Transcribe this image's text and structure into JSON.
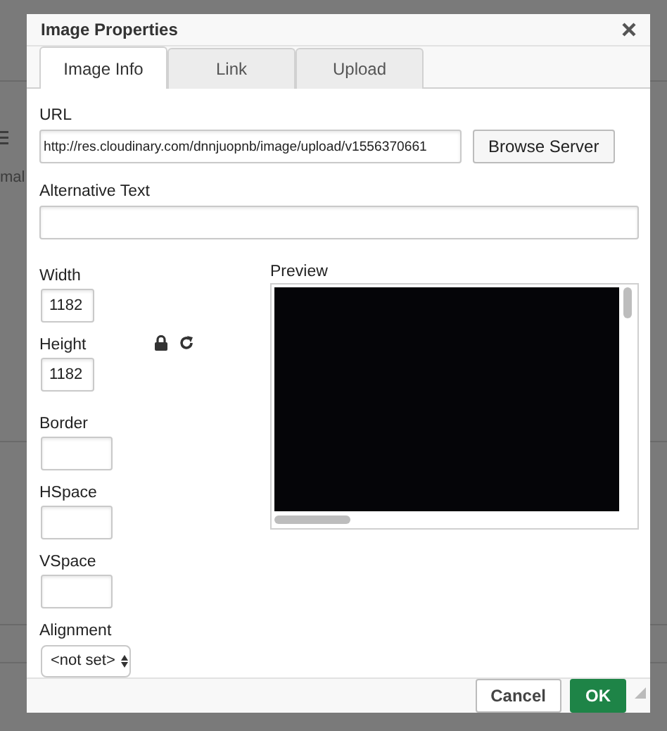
{
  "background": {
    "text": "mal"
  },
  "dialog": {
    "title": "Image Properties",
    "tabs": [
      {
        "label": "Image Info",
        "selected": true
      },
      {
        "label": "Link",
        "selected": false
      },
      {
        "label": "Upload",
        "selected": false
      }
    ],
    "url": {
      "label": "URL",
      "value": "http://res.cloudinary.com/dnnjuopnb/image/upload/v1556370661"
    },
    "browse_button": "Browse Server",
    "alt_text": {
      "label": "Alternative Text"
    },
    "width": {
      "label": "Width",
      "value": "1182"
    },
    "height": {
      "label": "Height",
      "value": "1182"
    },
    "border": {
      "label": "Border"
    },
    "hspace": {
      "label": "HSpace"
    },
    "vspace": {
      "label": "VSpace"
    },
    "alignment": {
      "label": "Alignment",
      "value": "<not set>"
    },
    "preview": {
      "label": "Preview"
    },
    "buttons": [
      {
        "label": "Cancel",
        "kind": "secondary"
      },
      {
        "label": "OK",
        "kind": "primary"
      }
    ]
  }
}
